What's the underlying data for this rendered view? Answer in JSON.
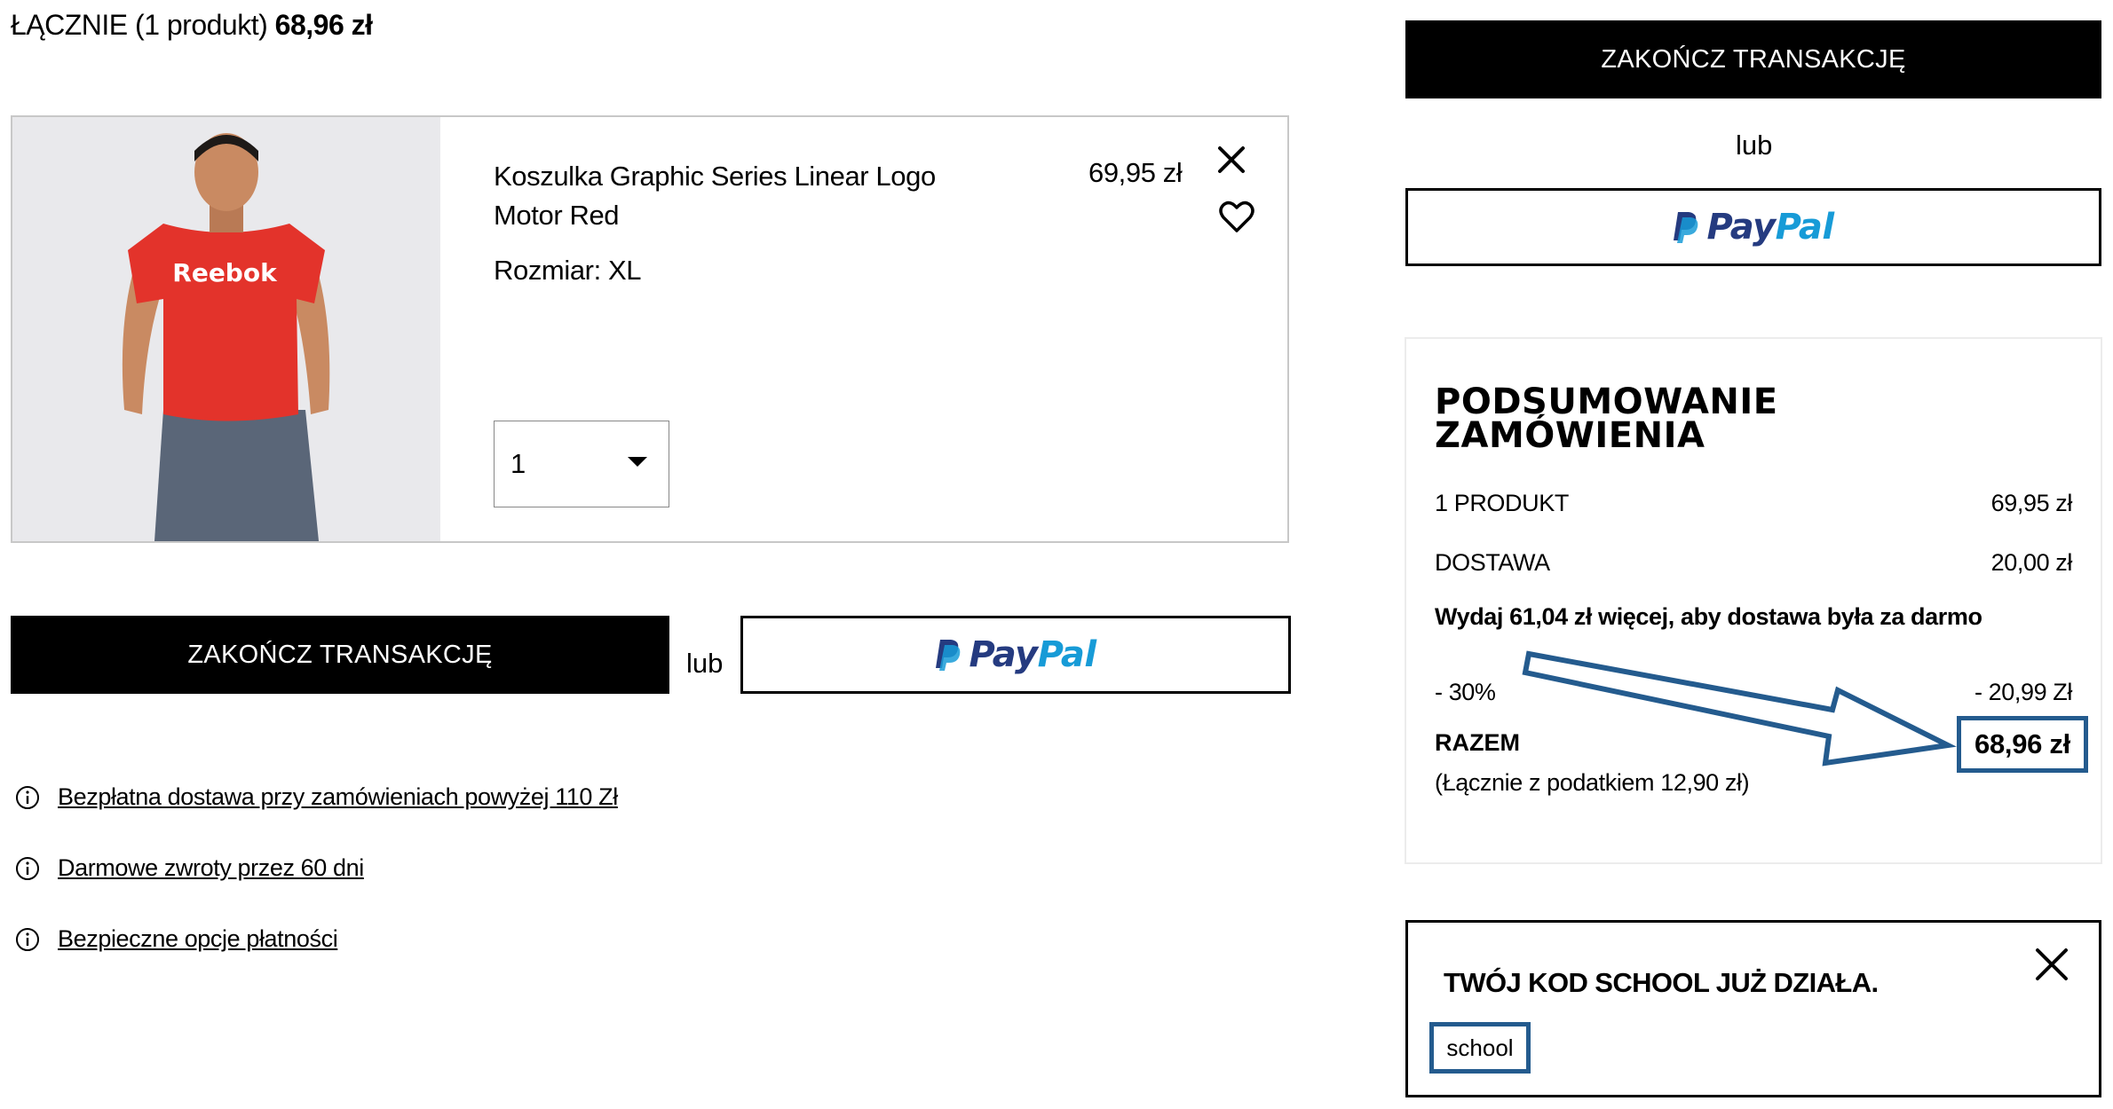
{
  "header": {
    "total_label": "ŁĄCZNIE (1 produkt)",
    "total_value": "68,96 zł"
  },
  "product": {
    "name": "Koszulka Graphic Series Linear Logo Motor Red",
    "size": "Rozmiar: XL",
    "price": "69,95 zł",
    "image_brand_text": "Reebok",
    "quantity": "1",
    "shirt_color": "#e3332b",
    "pants_color": "#5a6678"
  },
  "actions": {
    "checkout_label": "ZAKOŃCZ TRANSAKCJĘ",
    "or_label": "lub",
    "paypal_pay": "Pay",
    "paypal_pal": "Pal"
  },
  "info_links": [
    "Bezpłatna dostawa przy zamówieniach powyżej 110 Zł",
    "Darmowe zwroty przez 60 dni",
    "Bezpieczne opcje płatności"
  ],
  "summary": {
    "title": "PODSUMOWANIE ZAMÓWIENIA",
    "rows": [
      {
        "label": "1 PRODUKT",
        "value": "69,95 zł"
      },
      {
        "label": "DOSTAWA",
        "value": "20,00 zł"
      }
    ],
    "free_shipping_note": "Wydaj 61,04 zł więcej, aby dostawa była za darmo",
    "discount_label": "- 30%",
    "discount_value": "- 20,99 Zł",
    "total_label": "RAZEM",
    "total_value": "68,96 zł",
    "tax_note": "(Łącznie z podatkiem  12,90 zł)"
  },
  "promo": {
    "message": "TWÓJ KOD SCHOOL JUŻ DZIAŁA.",
    "code": "school"
  },
  "colors": {
    "highlight": "#245b8e",
    "paypal_dark": "#253b80",
    "paypal_light": "#179bd7"
  },
  "icons": [
    "close-icon",
    "heart-icon",
    "chevron-down-icon",
    "info-icon",
    "paypal-logo-icon",
    "arrow-annotation"
  ]
}
